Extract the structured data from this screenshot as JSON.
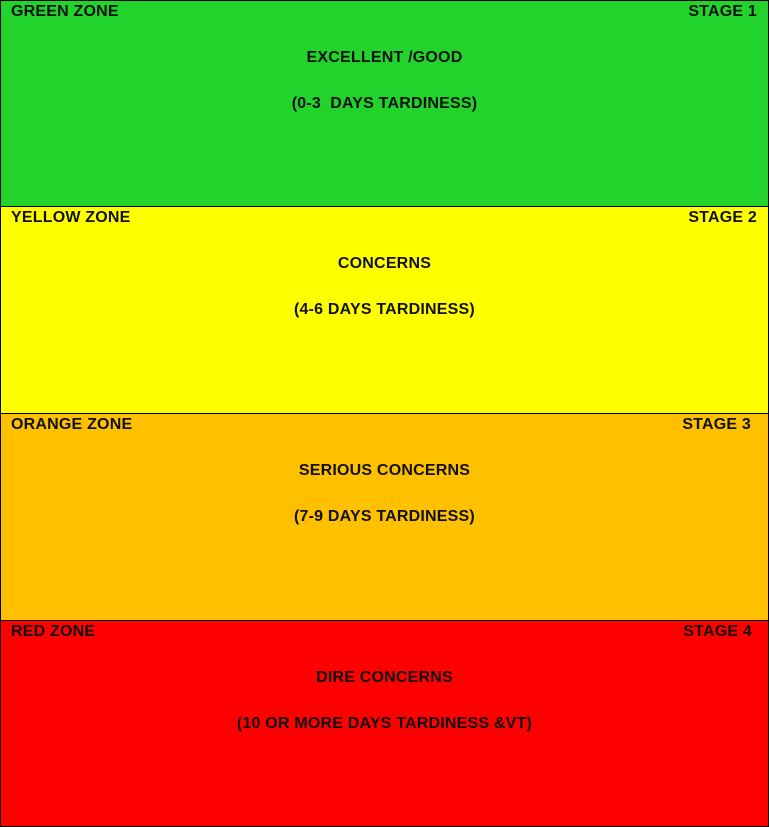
{
  "zones": [
    {
      "name": "GREEN ZONE",
      "stage": "STAGE 1",
      "rating": "EXCELLENT /GOOD",
      "range": "(0-3  DAYS TARDINESS)",
      "color": "#21d32a"
    },
    {
      "name": "YELLOW ZONE",
      "stage": "STAGE 2",
      "rating": "CONCERNS",
      "range": "(4-6 DAYS TARDINESS)",
      "color": "#ffff00"
    },
    {
      "name": "ORANGE ZONE",
      "stage": "STAGE 3",
      "rating": "SERIOUS CONCERNS",
      "range": "(7-9 DAYS TARDINESS)",
      "color": "#ffc000"
    },
    {
      "name": "RED ZONE",
      "stage": "STAGE 4",
      "rating": "DIRE CONCERNS",
      "range": "(10 OR MORE DAYS TARDINESS &VT)",
      "color": "#ff0000"
    }
  ]
}
